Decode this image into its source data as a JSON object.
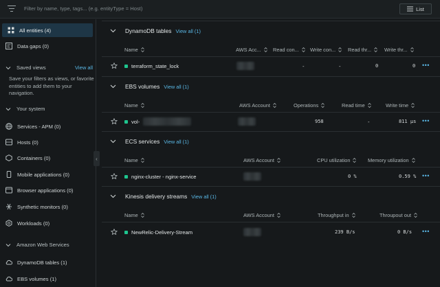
{
  "topbar": {
    "filter_placeholder": "Filter by name, type, tags... (e.g. entityType = Host)",
    "list_label": "List"
  },
  "sidebar": {
    "all_entities": "All entities (4)",
    "data_gaps": "Data gaps (0)",
    "saved_views": "Saved views",
    "view_all": "View all",
    "saved_desc": "Save your filters as views, or favorite entities to add them to your navigation.",
    "your_system": "Your system",
    "system_items": [
      "Services - APM (0)",
      "Hosts (0)",
      "Containers (0)",
      "Mobile applications (0)",
      "Browser applications (0)",
      "Synthetic monitors (0)",
      "Workloads (0)"
    ],
    "aws": "Amazon Web Services",
    "aws_items": [
      "DynamoDB tables (1)",
      "EBS volumes (1)"
    ]
  },
  "cards": {
    "dynamo": {
      "title": "DynamoDB tables",
      "view_all": "View all (1)",
      "headers": [
        "Name",
        "AWS Acc...",
        "Read con...",
        "Write con...",
        "Read thr...",
        "Write thr..."
      ],
      "row": {
        "name": "terraform_state_lock",
        "read_con": "-",
        "write_con": "-",
        "read_thr": "0",
        "write_thr": "0"
      }
    },
    "ebs": {
      "title": "EBS volumes",
      "view_all": "View all (1)",
      "headers": [
        "Name",
        "AWS Account",
        "Operations",
        "Read time",
        "Write time"
      ],
      "row": {
        "name": "vol-",
        "operations": "958",
        "read_time": "-",
        "write_time": "811 µs"
      }
    },
    "ecs": {
      "title": "ECS services",
      "view_all": "View all (1)",
      "headers": [
        "Name",
        "AWS Account",
        "CPU utilization",
        "Memory utilization"
      ],
      "row": {
        "name": "nginx-cluster - nginx-service",
        "cpu": "0 %",
        "memory": "0.59 %"
      }
    },
    "kinesis": {
      "title": "Kinesis delivery streams",
      "view_all": "View all (1)",
      "headers": [
        "Name",
        "AWS Account",
        "Throughput in",
        "Throupout out"
      ],
      "row": {
        "name": "NewRelic-Delivery-Stream",
        "in": "239 B/s",
        "out": "0 B/s"
      }
    }
  },
  "colors": {
    "accent": "#5ab8e6",
    "status_ok": "#1ec58e",
    "active_bg": "#1e3646"
  },
  "icons": [
    "filter-icon",
    "list-icon",
    "grid-icon",
    "data-gaps-icon",
    "chevron-down-icon",
    "globe-icon",
    "server-icon",
    "container-icon",
    "mobile-icon",
    "browser-icon",
    "synthetic-icon",
    "workload-icon",
    "cloud-icon",
    "star-icon",
    "sort-icon",
    "more-icon"
  ]
}
